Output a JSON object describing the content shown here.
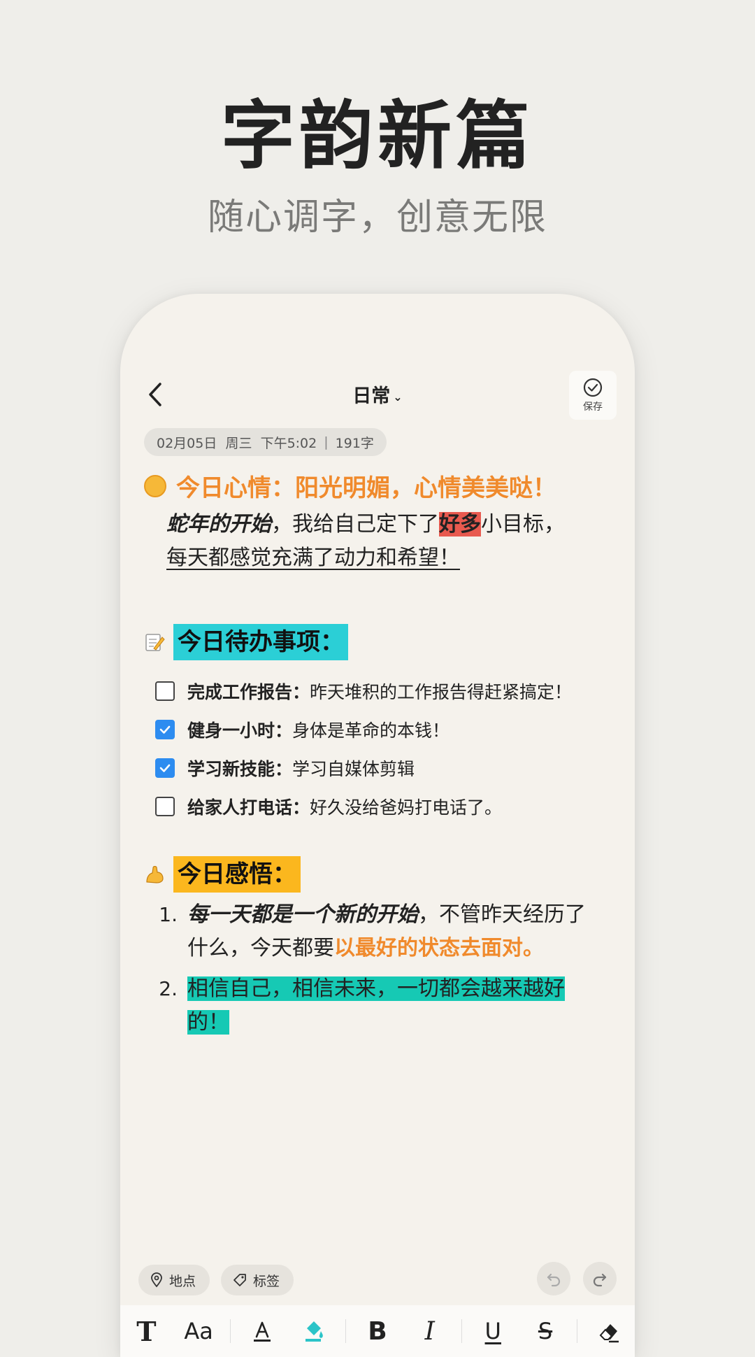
{
  "hero": {
    "title": "字韵新篇",
    "subtitle": "随心调字，创意无限"
  },
  "editor": {
    "title": "日常",
    "save_label": "保存",
    "meta": {
      "date": "02月05日",
      "weekday": "周三",
      "time": "下午5:02",
      "separator": "|",
      "word_count": "191字"
    },
    "mood": "今日心情：阳光明媚，心情美美哒！",
    "para": {
      "part1": "蛇年的开始",
      "part2": "，我给自己定下了",
      "part3": "好多",
      "part4": "小目标，",
      "line2": "每天都感觉充满了动力和希望！"
    },
    "todo_header": "今日待办事项：",
    "todos": [
      {
        "title": "完成工作报告：",
        "desc": "昨天堆积的工作报告得赶紧搞定！",
        "checked": false
      },
      {
        "title": "健身一小时：",
        "desc": "身体是革命的本钱！",
        "checked": true
      },
      {
        "title": "学习新技能：",
        "desc": "学习自媒体剪辑",
        "checked": true
      },
      {
        "title": "给家人打电话：",
        "desc": "好久没给爸妈打电话了。",
        "checked": false
      }
    ],
    "insight_header": "今日感悟：",
    "insights": {
      "item1": {
        "num": "1.",
        "bold": "每一天都是一个新的开始",
        "plain": "，不管昨天经历了什么，今天都要",
        "orange": "以最好的状态去面对。"
      },
      "item2": {
        "num": "2.",
        "text": "相信自己，相信未来，一切都会越来越好的！"
      }
    },
    "chips": {
      "location": "地点",
      "tag": "标签"
    },
    "toolbar": {
      "text_style": "T",
      "font_size": "Aa",
      "bold": "B",
      "italic": "I",
      "underline": "U",
      "strike": "S"
    }
  },
  "colors": {
    "accent_orange": "#f08a2c",
    "highlight_red": "#e85a4f",
    "highlight_cyan": "#2bcfd6",
    "highlight_yellow": "#fbb71e",
    "highlight_teal": "#16c9b4",
    "checkbox_blue": "#2d8cf0"
  },
  "icons": {
    "mood": "sun-emoji-icon",
    "todo": "memo-emoji-icon",
    "insight": "flexed-arm-emoji-icon",
    "back": "chevron-left-icon",
    "save": "check-circle-icon",
    "location": "location-pin-icon",
    "tag": "tag-icon",
    "undo": "undo-icon",
    "redo": "redo-icon",
    "fill": "paint-bucket-icon",
    "eraser": "eraser-icon"
  }
}
